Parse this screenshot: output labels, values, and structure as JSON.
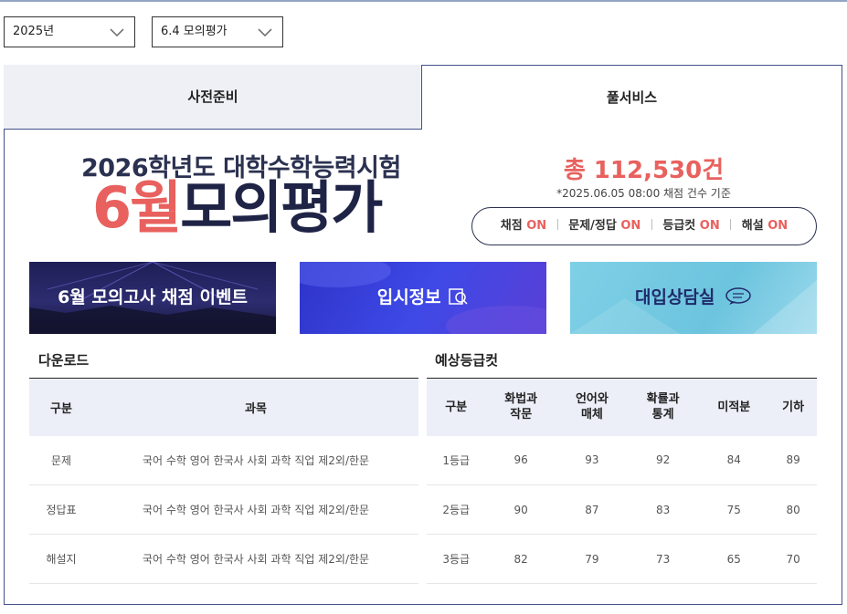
{
  "filters": {
    "year": "2025년",
    "exam": "6.4 모의평가"
  },
  "tabs": [
    {
      "label": "사전준비",
      "active": false
    },
    {
      "label": "풀서비스",
      "active": true
    }
  ],
  "hero": {
    "subtitle": "2026학년도 대학수학능력시험",
    "title_accent": "6월",
    "title_rest": "모의평가"
  },
  "stats": {
    "total": "총 112,530건",
    "basis": "*2025.06.05 08:00 채점 건수 기준"
  },
  "services": [
    {
      "label": "채점",
      "status": "ON"
    },
    {
      "label": "문제/정답",
      "status": "ON"
    },
    {
      "label": "등급컷",
      "status": "ON"
    },
    {
      "label": "해설",
      "status": "ON"
    }
  ],
  "banners": [
    {
      "label": "6월 모의고사 채점 이벤트"
    },
    {
      "label": "입시정보"
    },
    {
      "label": "대입상담실"
    }
  ],
  "download": {
    "title": "다운로드",
    "headers": [
      "구분",
      "과목"
    ],
    "rows": [
      {
        "type": "문제",
        "subjects": "국어 수학 영어 한국사 사회 과학 직업 제2외/한문"
      },
      {
        "type": "정답표",
        "subjects": "국어 수학 영어 한국사 사회 과학 직업 제2외/한문"
      },
      {
        "type": "해설지",
        "subjects": "국어 수학 영어 한국사 사회 과학 직업 제2외/한문"
      }
    ]
  },
  "grade_cut": {
    "title": "예상등급컷",
    "headers": [
      "구분",
      "화법과\n작문",
      "언어와\n매체",
      "확률과\n통계",
      "미적분",
      "기하"
    ],
    "rows": [
      {
        "grade": "1등급",
        "values": [
          "96",
          "93",
          "92",
          "84",
          "89"
        ]
      },
      {
        "grade": "2등급",
        "values": [
          "90",
          "87",
          "83",
          "75",
          "80"
        ]
      },
      {
        "grade": "3등급",
        "values": [
          "82",
          "79",
          "73",
          "65",
          "70"
        ]
      }
    ]
  },
  "colors": {
    "accent": "#e8615e",
    "navy": "#1f2446",
    "border": "#44508a"
  }
}
